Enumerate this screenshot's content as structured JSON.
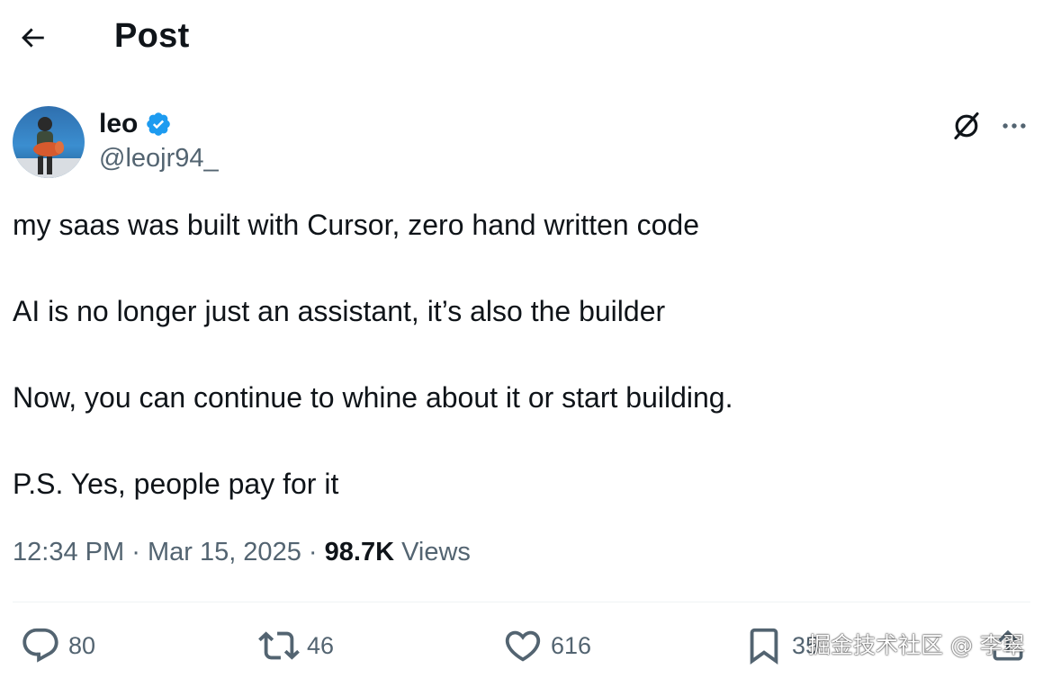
{
  "header": {
    "title": "Post"
  },
  "author": {
    "name": "leo",
    "handle": "@leojr94_",
    "verified": true
  },
  "tweet": {
    "paragraphs": [
      "my saas was built with Cursor, zero hand written code",
      "AI is no longer just an assistant, it’s also the builder",
      "Now, you can continue to whine about it or start building.",
      "P.S. Yes, people pay for it"
    ]
  },
  "meta": {
    "time": "12:34 PM",
    "separator": "·",
    "date": "Mar 15, 2025",
    "views_count": "98.7K",
    "views_label": "Views"
  },
  "actions": {
    "replies": "80",
    "reposts": "46",
    "likes": "616",
    "bookmarks": "35"
  },
  "watermark": "掘金技术社区 @ 李翠",
  "colors": {
    "text": "#0f1419",
    "secondary": "#536471",
    "verified": "#1d9bf0",
    "divider": "#eff3f4"
  },
  "icons": [
    "back-arrow-icon",
    "verified-badge-icon",
    "grok-icon",
    "more-icon",
    "reply-icon",
    "repost-icon",
    "like-icon",
    "bookmark-icon",
    "share-icon"
  ]
}
